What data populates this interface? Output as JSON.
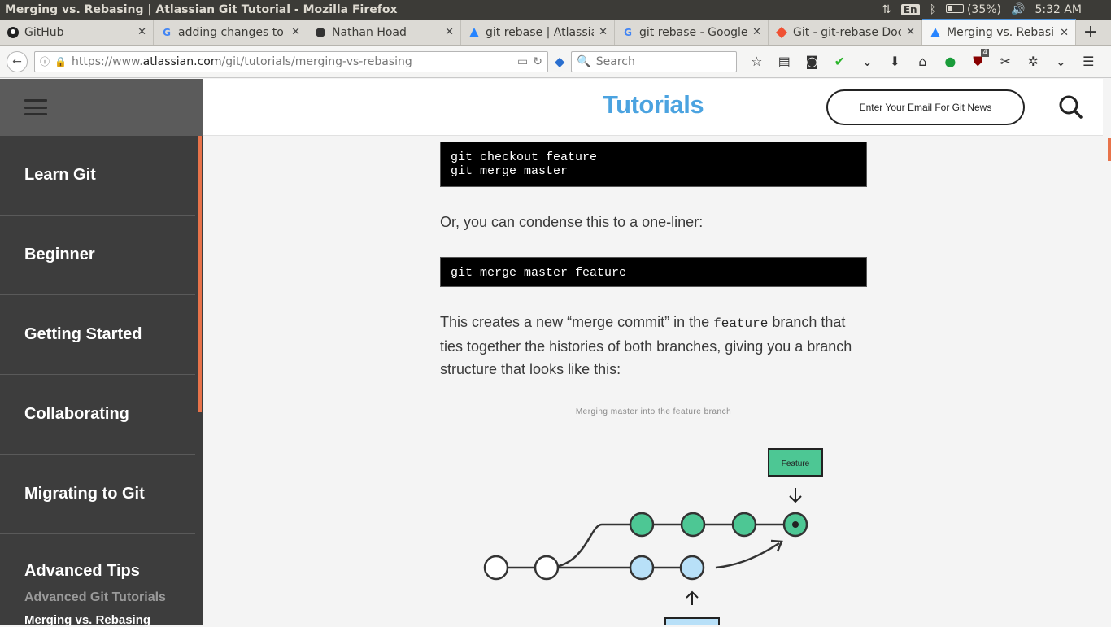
{
  "os": {
    "window_title": "Merging vs. Rebasing | Atlassian Git Tutorial - Mozilla Firefox",
    "lang": "En",
    "battery": "(35%)",
    "clock": "5:32 AM"
  },
  "tabs": [
    {
      "label": "GitHub",
      "icon": "github-icon"
    },
    {
      "label": "adding changes to",
      "icon": "google-icon"
    },
    {
      "label": "Nathan Hoad",
      "icon": "site-icon"
    },
    {
      "label": "git rebase | Atlassia",
      "icon": "atlassian-icon"
    },
    {
      "label": "git rebase - Google",
      "icon": "google-icon"
    },
    {
      "label": "Git - git-rebase Doc",
      "icon": "git-icon"
    },
    {
      "label": "Merging vs. Rebasi",
      "icon": "atlassian-icon",
      "active": true
    }
  ],
  "nav": {
    "url_prefix": "https://www.",
    "url_domain": "atlassian.com",
    "url_path": "/git/tutorials/merging-vs-rebasing",
    "search_placeholder": "Search",
    "ublock_count": "4"
  },
  "sidebar": {
    "items": [
      "Learn Git",
      "Beginner",
      "Getting Started",
      "Collaborating",
      "Migrating to Git"
    ],
    "last_item": "Advanced Tips",
    "sub_item": "Advanced Git Tutorials",
    "current_page": "Merging vs. Rebasing"
  },
  "header": {
    "brand": "Tutorials",
    "email_button": "Enter Your Email For Git News"
  },
  "content": {
    "code1": "git checkout feature\ngit merge master",
    "para1": "Or, you can condense this to a one-liner:",
    "code2": "git merge master feature",
    "para2_a": "This creates a new “merge commit” in the ",
    "para2_code": "feature",
    "para2_b": " branch that ties together the histories of both branches, giving you a branch structure that looks like this:",
    "figure_caption": "Merging master into the feature branch",
    "figure_label": "Feature"
  },
  "colors": {
    "accent": "#e8734a",
    "brand": "#4ba3e0",
    "feature_node": "#4dc794",
    "master_node": "#b8e0f8"
  }
}
